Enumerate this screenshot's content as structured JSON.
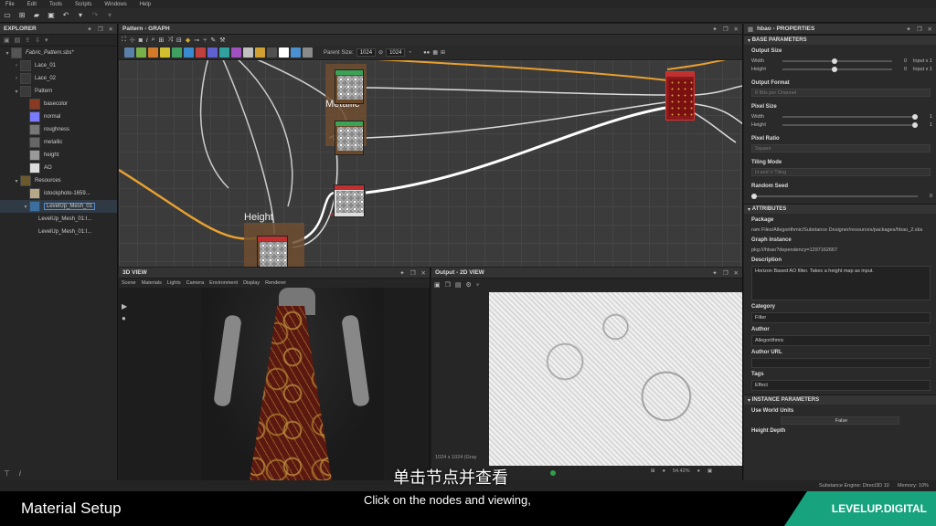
{
  "menu": [
    "File",
    "Edit",
    "Tools",
    "Scripts",
    "Windows",
    "Help"
  ],
  "explorer": {
    "title": "EXPLORER",
    "items": [
      {
        "label": "Fabric_Pattern.sbs*",
        "indent": 0,
        "arrow": "v",
        "italic": true,
        "color": "#555"
      },
      {
        "label": "Lace_01",
        "indent": 1,
        "arrow": ">",
        "color": "#3a3a3a"
      },
      {
        "label": "Lace_02",
        "indent": 1,
        "arrow": ">",
        "color": "#3a3a3a"
      },
      {
        "label": "Pattern",
        "indent": 1,
        "arrow": "v",
        "color": "#3a3a3a"
      },
      {
        "label": "basecolor",
        "indent": 2,
        "arrow": "",
        "color": "#8a3a22"
      },
      {
        "label": "normal",
        "indent": 2,
        "arrow": "",
        "color": "#7b7bff"
      },
      {
        "label": "roughness",
        "indent": 2,
        "arrow": "",
        "color": "#777"
      },
      {
        "label": "metallic",
        "indent": 2,
        "arrow": "",
        "color": "#666"
      },
      {
        "label": "height",
        "indent": 2,
        "arrow": "",
        "color": "#999"
      },
      {
        "label": "AO",
        "indent": 2,
        "arrow": "",
        "color": "#ddd"
      },
      {
        "label": "Resources",
        "indent": 1,
        "arrow": "v",
        "color": "#6b5a2a"
      },
      {
        "label": "istockphoto-1659...",
        "indent": 2,
        "arrow": "",
        "color": "#b8a88a"
      },
      {
        "label": "LevelUp_Mesh_01",
        "indent": 2,
        "arrow": "v",
        "color": "#3d6ea0",
        "selected": true
      },
      {
        "label": "LevelUp_Mesh_01:I...",
        "indent": 3,
        "arrow": "",
        "color": ""
      },
      {
        "label": "LevelUp_Mesh_01:I...",
        "indent": 3,
        "arrow": "",
        "color": ""
      }
    ]
  },
  "graph": {
    "title": "Pattern - GRAPH",
    "parent_size_label": "Parent Size:",
    "parent_size": "1024",
    "size2": "1024",
    "labels": {
      "metallic": "Metallic",
      "height": "Height"
    },
    "node_palette": [
      "#5a7fa8",
      "#7ab04a",
      "#d07a2a",
      "#d0c030",
      "#40a060",
      "#3a8ad0",
      "#c04040",
      "#6060d0",
      "#30a0a0",
      "#a050c0",
      "#c0c0c0",
      "#d0a030",
      "#505050",
      "#ffffff",
      "#4a90d0",
      "#8a8a8a"
    ]
  },
  "view3d": {
    "title": "3D VIEW",
    "tabs": [
      "Scene",
      "Materials",
      "Lights",
      "Camera",
      "Environment",
      "Display",
      "Renderer"
    ]
  },
  "view2d": {
    "title": "Output - 2D VIEW",
    "resolution": "1024 x 1024 (Gray",
    "zoom": "54.42%"
  },
  "properties": {
    "title": "hbao - PROPERTIES",
    "base_section": "BASE PARAMETERS",
    "output_size": "Output Size",
    "width": "Width",
    "height": "Height",
    "width_val": "0",
    "height_val": "0",
    "width_rel": "Input x 1",
    "height_rel": "Input x 1",
    "output_format": "Output Format",
    "output_format_val": "8 Bits per Channel",
    "pixel_size": "Pixel Size",
    "px_width_val": "1",
    "px_height_val": "1",
    "pixel_ratio": "Pixel Ratio",
    "pixel_ratio_val": "Square",
    "tiling_mode": "Tiling Mode",
    "tiling_mode_val": "H and V Tiling",
    "random_seed": "Random Seed",
    "random_seed_val": "0",
    "attr_section": "ATTRIBUTES",
    "package": "Package",
    "package_val": "ram Files/Allegorithmic/Substance Designer/resources/packages/hbao_2.sbs",
    "graph_instance": "Graph instance",
    "graph_instance_val": "pkg:///hbao?dependency=1297162667",
    "description": "Description",
    "description_val": "Horizon Based AO filter. Takes a height map as input.",
    "category": "Category",
    "category_val": "Filter",
    "author": "Author",
    "author_val": "Allegorithmic",
    "author_url": "Author URL",
    "tags": "Tags",
    "tags_val": "Effect",
    "instance_section": "INSTANCE PARAMETERS",
    "use_world_units": "Use World Units",
    "use_world_units_val": "False",
    "height_depth": "Height Depth"
  },
  "status": {
    "engine": "Substance Engine: Direct3D 10",
    "memory": "Memory: 10%"
  },
  "captions": {
    "chinese": "单击节点并查看",
    "english": "Click on the nodes and viewing,",
    "lesson": "Material Setup",
    "brand": "LEVELUP.DIGITAL"
  }
}
